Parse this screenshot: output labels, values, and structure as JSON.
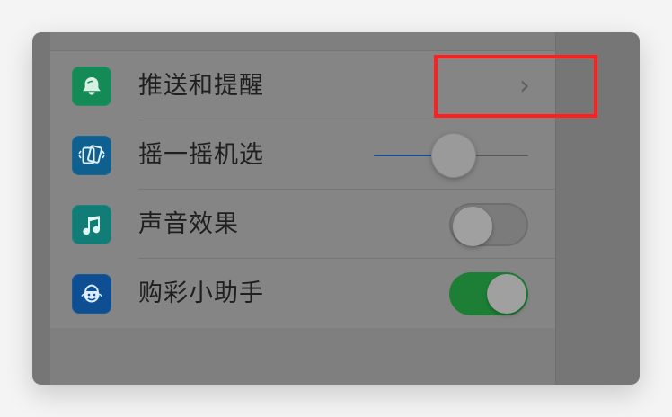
{
  "settings": {
    "rows": [
      {
        "label": "推送和提醒",
        "icon": "notification-bell-icon",
        "icon_color": "#148a57",
        "control": "chevron"
      },
      {
        "label": "摇一摇机选",
        "icon": "shake-phones-icon",
        "icon_color": "#0f5f8f",
        "control": "slider",
        "slider_value": 0.52
      },
      {
        "label": "声音效果",
        "icon": "music-note-icon",
        "icon_color": "#127d76",
        "control": "toggle",
        "enabled": false
      },
      {
        "label": "购彩小助手",
        "icon": "assistant-mascot-icon",
        "icon_color": "#0d4f92",
        "control": "toggle",
        "enabled": true
      }
    ]
  },
  "colors": {
    "highlight": "#ff1f1f",
    "slider_active": "#1d4f98",
    "toggle_on": "#1d7f36"
  }
}
